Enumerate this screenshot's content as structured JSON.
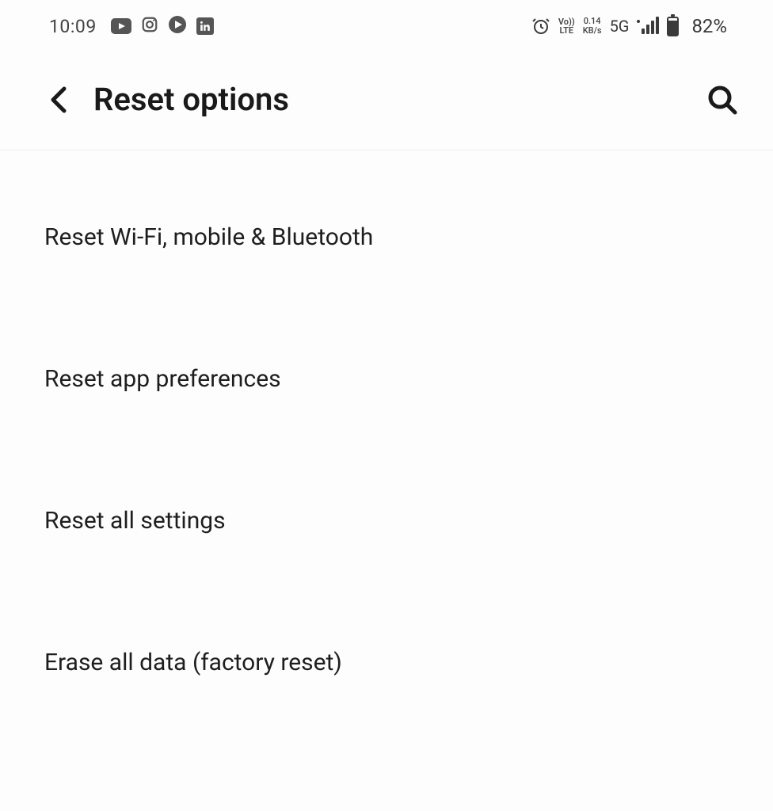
{
  "status_bar": {
    "time": "10:09",
    "icons_left": [
      "youtube-icon",
      "instagram-icon",
      "play-icon",
      "linkedin-icon"
    ],
    "alarm_icon": "alarm-icon",
    "lte_top": "Vo))",
    "lte_bottom": "LTE",
    "net_speed_top": "0.14",
    "net_speed_bottom": "KB/s",
    "network_type": "5G",
    "battery_pct": "82%"
  },
  "header": {
    "title": "Reset options"
  },
  "options": [
    {
      "label": "Reset Wi-Fi, mobile & Bluetooth",
      "name": "option-reset-network"
    },
    {
      "label": "Reset app preferences",
      "name": "option-reset-app-prefs"
    },
    {
      "label": "Reset all settings",
      "name": "option-reset-all-settings"
    },
    {
      "label": "Erase all data (factory reset)",
      "name": "option-factory-reset"
    }
  ]
}
